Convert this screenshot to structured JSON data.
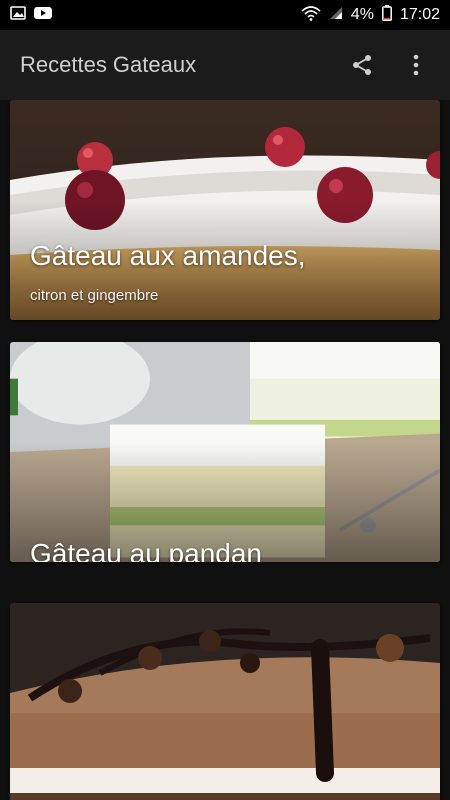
{
  "status_bar": {
    "battery": "4%",
    "time": "17:02",
    "icons": [
      "image-notification-icon",
      "youtube-notification-icon",
      "wifi-icon",
      "signal-icon",
      "battery-icon"
    ]
  },
  "app_bar": {
    "title": "Recettes Gateaux",
    "actions": [
      "share-icon",
      "more-vert-icon"
    ]
  },
  "recipes": [
    {
      "title": "Gâteau aux amandes,",
      "subtitle": "citron et gingembre"
    },
    {
      "title": "Gâteau au pandan",
      "subtitle": ""
    },
    {
      "title": "",
      "subtitle": ""
    }
  ],
  "colors": {
    "status_bar_bg": "#000000",
    "app_bar_bg": "#1b1b1b",
    "title_text": "#cfcfcf",
    "page_bg": "#101010"
  }
}
